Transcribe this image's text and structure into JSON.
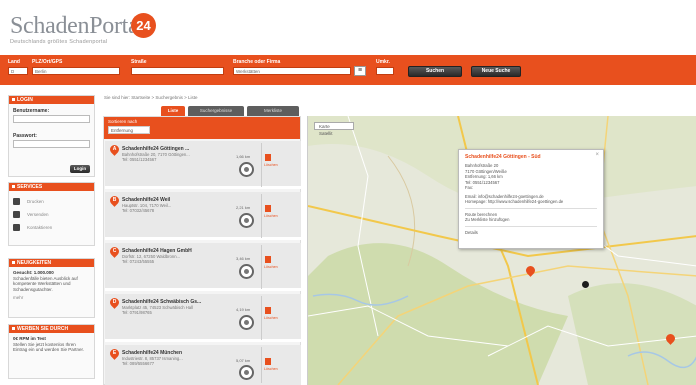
{
  "logo": {
    "name_schaden": "Schaden",
    "name_portal": "Portal",
    "badge": "24",
    "tagline": "Deutschlands größtes Schadenportal"
  },
  "search": {
    "fields": [
      {
        "label": "Land",
        "value": "D"
      },
      {
        "label": "PLZ/Ort/GPS",
        "value": "Berlin"
      },
      {
        "label": "Straße",
        "value": ""
      },
      {
        "label": "Branche oder Firma",
        "value": "Werkstätten"
      },
      {
        "label": "Umkr.",
        "value": ""
      }
    ],
    "search_button": "Suchen",
    "new_search_button": "Neue Suche"
  },
  "sidebar": {
    "login": {
      "title": "LOGIN",
      "user_label": "Benutzername:",
      "pass_label": "Passwort:",
      "button": "Login"
    },
    "services": {
      "title": "SERVICES",
      "items": [
        "Drucken",
        "Versenden",
        "Kontaktieren"
      ]
    },
    "info_box": {
      "title": "NEUIGKEITEN",
      "heading": "Gesucht: 1.000.000",
      "text": "Schadenfälle bieten Ausblick auf kompetente Werkstätten und Schadensgutachter.",
      "more": "mehr"
    },
    "partner_box": {
      "title": "WERBEN SIE DURCH",
      "heading": "0€ RPM im Test",
      "text": "Stellen Sie jetzt kostenlos Ihren Eintrag ein und werden Sie Partner."
    }
  },
  "breadcrumb": "Sie sind hier: Startseite > Suchergebnis > Liste",
  "tabs": [
    "Liste",
    "Suchergebnisse",
    "Merkliste"
  ],
  "filter": {
    "label": "Sortieren nach",
    "value": "Entfernung"
  },
  "results": [
    {
      "marker": "A",
      "title": "Schadenhilfe24 Göttingen ...",
      "address": "Bahnhofstraße 20, 7170 Göttingen...",
      "phone": "Tel: 0551/1234567",
      "distance": "1,66 km",
      "delete": "Löschen"
    },
    {
      "marker": "B",
      "title": "Schadenhilfe24 Weil",
      "address": "Hauptstr. 104, 7170 Weil...",
      "phone": "Tel: 07032/45678",
      "distance": "2,21 km",
      "delete": "Löschen"
    },
    {
      "marker": "C",
      "title": "Schadenhilfe24 Hagen GmbH",
      "address": "Dorfstr. 12, 67250 Waldbronn...",
      "phone": "Tel: 07243/55555",
      "distance": "3,46 km",
      "delete": "Löschen"
    },
    {
      "marker": "D",
      "title": "Schadenhilfe24 Schwäbisch Gs...",
      "address": "Marktplatz 45, 74523 Schwäbisch Hall",
      "phone": "Tel: 0791/98765",
      "distance": "4,19 km",
      "delete": "Löschen"
    },
    {
      "marker": "E",
      "title": "Schadenhilfe24 München",
      "address": "Industriestr. 8, 85737 Ismaning...",
      "phone": "Tel: 089/5556677",
      "distance": "5,07 km",
      "delete": "Löschen"
    }
  ],
  "map": {
    "type_map": "Karte",
    "type_sat": "Satellit",
    "info": {
      "title": "Schadenhilfe24 Göttingen - Süd",
      "lines": [
        "Bahnhofstraße 20",
        "7170 Göttingen/Weiße",
        "Entfernung: 1,66 km",
        "Tel: 0551/1234567",
        "Fax:"
      ],
      "web_lines": [
        "Email: info@schadenhilfe24-goettingen.de",
        "Homepage: http://www.schadenhilfe24-goettingen.de"
      ],
      "links": [
        "Route berechnen",
        "Zu Merkliste hinzufügen"
      ],
      "details": "Details"
    }
  },
  "colors": {
    "brand": "#e8501e",
    "dark_button": "#2a2a2a"
  }
}
